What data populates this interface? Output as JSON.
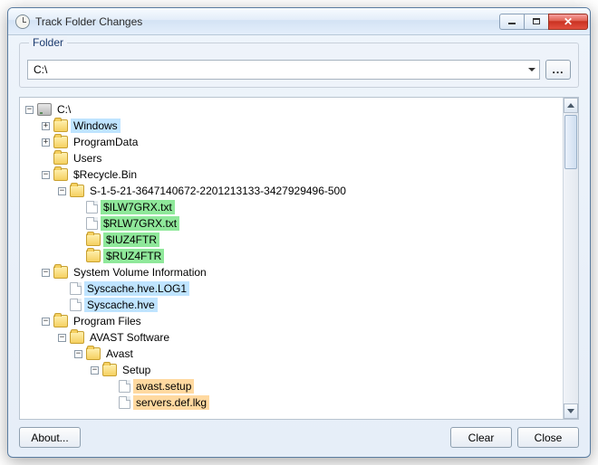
{
  "window": {
    "title": "Track Folder Changes"
  },
  "folder_group": {
    "label": "Folder",
    "path": "C:\\"
  },
  "buttons": {
    "about": "About...",
    "clear": "Clear",
    "close": "Close",
    "browse": "..."
  },
  "tree": {
    "root": {
      "label": "C:\\"
    },
    "windows": {
      "label": "Windows"
    },
    "programdata": {
      "label": "ProgramData"
    },
    "users": {
      "label": "Users"
    },
    "recycle": {
      "label": "$Recycle.Bin"
    },
    "sid": {
      "label": "S-1-5-21-3647140672-2201213133-3427929496-500"
    },
    "ilw": {
      "label": "$ILW7GRX.txt"
    },
    "rlw": {
      "label": "$RLW7GRX.txt"
    },
    "iuz": {
      "label": "$IUZ4FTR"
    },
    "ruz": {
      "label": "$RUZ4FTR"
    },
    "svi": {
      "label": "System Volume Information"
    },
    "syslog": {
      "label": "Syscache.hve.LOG1"
    },
    "syshve": {
      "label": "Syscache.hve"
    },
    "pf": {
      "label": "Program Files"
    },
    "avastsw": {
      "label": "AVAST Software"
    },
    "avast": {
      "label": "Avast"
    },
    "setup": {
      "label": "Setup"
    },
    "avastsetup": {
      "label": "avast.setup"
    },
    "serversdef": {
      "label": "servers.def.lkg"
    }
  }
}
